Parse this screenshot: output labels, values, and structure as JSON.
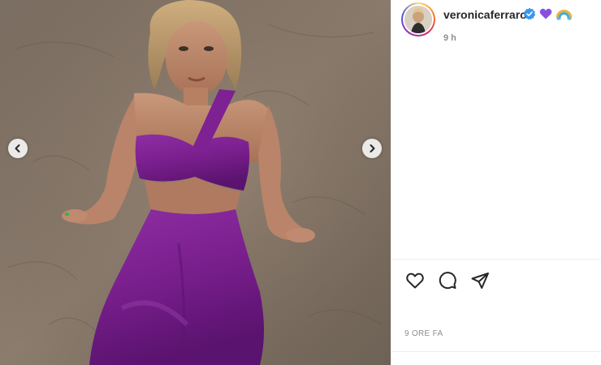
{
  "post": {
    "media_alt": "",
    "carousel": {
      "prev_icon": "chevron-left-icon",
      "next_icon": "chevron-right-icon"
    }
  },
  "header": {
    "username": "veronicaferraro",
    "verified_icon": "verified-badge-icon",
    "emojis": [
      "purple-heart-emoji",
      "rainbow-emoji"
    ],
    "time": "9 h"
  },
  "actions": {
    "like_icon": "heart-icon",
    "comment_icon": "comment-icon",
    "share_icon": "paper-plane-icon"
  },
  "footer": {
    "timestamp": "9 ORE FA"
  },
  "colors": {
    "verified": "#3897f0",
    "purple_heart": "#8a4fe0",
    "text_primary": "#262626",
    "text_secondary": "#8e8e8e",
    "divider": "#efefef",
    "dress": "#7a1f8e",
    "sand": "#8a7b6c"
  }
}
